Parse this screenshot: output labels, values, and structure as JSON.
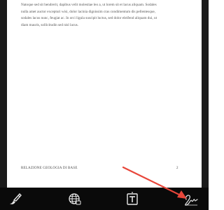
{
  "document": {
    "body_lines": [
      "Natoque sed sit hendrerit, dapibus velit molestiae leo a, ut lorem sit et lacus aliquam. Sodales",
      "nulla amet auctor excepturi wisi, dolor lacinia dignissim cras condimentum dis pellentesque,",
      "sodales lacus nunc, feugiat ac. In orci ligula suscipit luctus, sed dolor eleifend aliquam dui, ut",
      "diam mauris, sollicitudin sed nisl lacus."
    ],
    "footer_title": "RELAZIONE GEOLOGIA DI BASE",
    "page_number": "2"
  },
  "toolbar": {
    "tools": [
      {
        "name": "draw-tool",
        "icon": "pen-brush-icon"
      },
      {
        "name": "web-tool",
        "icon": "globe-network-icon"
      },
      {
        "name": "text-tool",
        "icon": "text-box-icon"
      },
      {
        "name": "signature-tool",
        "icon": "signature-icon"
      }
    ]
  },
  "colors": {
    "toolbar_bg": "#0a0a0a",
    "bezel": "#1b1b1b",
    "icon": "#e8e8e8",
    "annotation_arrow": "#e8463a"
  }
}
